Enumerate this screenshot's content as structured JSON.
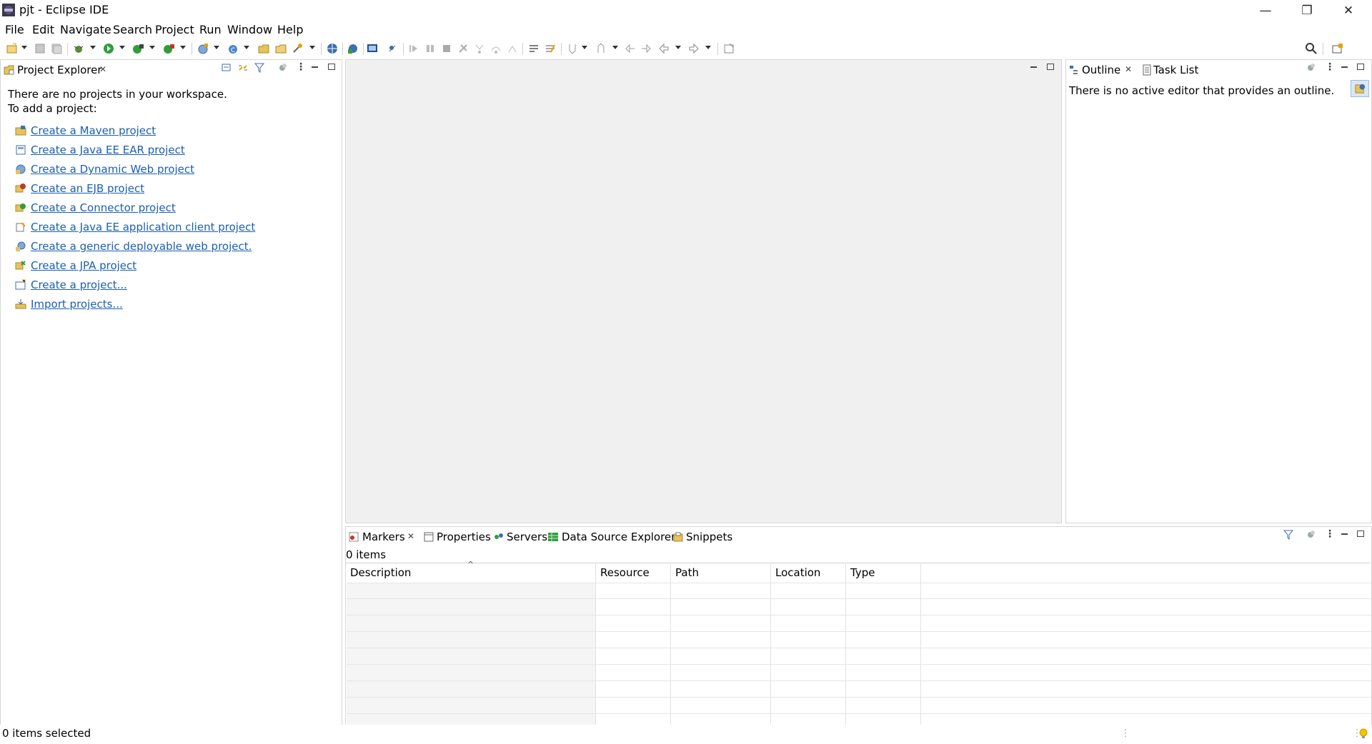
{
  "window": {
    "title": "pjt - Eclipse IDE",
    "controls": {
      "minimize": "—",
      "restore": "❐",
      "close": "✕"
    }
  },
  "menu": [
    "File",
    "Edit",
    "Navigate",
    "Search",
    "Project",
    "Run",
    "Window",
    "Help"
  ],
  "project_explorer": {
    "tab_label": "Project Explorer",
    "message_line1": "There are no projects in your workspace.",
    "message_line2": "To add a project:",
    "links": [
      {
        "label": "Create a Maven project",
        "icon": "maven-project-icon"
      },
      {
        "label": "Create a Java EE EAR project",
        "icon": "ear-project-icon"
      },
      {
        "label": "Create a Dynamic Web project",
        "icon": "web-project-icon"
      },
      {
        "label": "Create an EJB project",
        "icon": "ejb-project-icon"
      },
      {
        "label": "Create a Connector project",
        "icon": "connector-project-icon"
      },
      {
        "label": "Create a Java EE application client project",
        "icon": "app-client-project-icon"
      },
      {
        "label": "Create a generic deployable web project.",
        "icon": "generic-web-project-icon"
      },
      {
        "label": "Create a JPA project",
        "icon": "jpa-project-icon"
      },
      {
        "label": "Create a project...",
        "icon": "new-project-icon"
      },
      {
        "label": "Import projects...",
        "icon": "import-projects-icon"
      }
    ]
  },
  "outline": {
    "tabs": [
      "Outline",
      "Task List"
    ],
    "message": "There is no active editor that provides an outline."
  },
  "bottom_panel": {
    "tabs": [
      "Markers",
      "Properties",
      "Servers",
      "Data Source Explorer",
      "Snippets"
    ],
    "item_count": "0 items",
    "columns": [
      "Description",
      "Resource",
      "Path",
      "Location",
      "Type"
    ]
  },
  "status_bar": {
    "text": "0 items selected"
  },
  "colors": {
    "link": "#1a5fb4",
    "editor_bg": "#f0f0f0",
    "panel_border": "#d6d6d6"
  }
}
